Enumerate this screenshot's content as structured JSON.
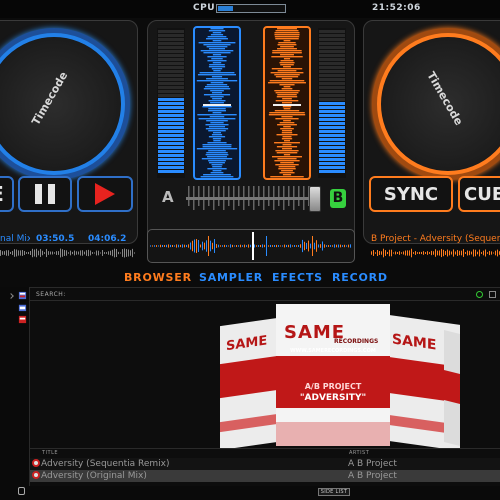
{
  "topbar": {
    "cpu_label": "CPU",
    "cpu_load": 0.22,
    "clock": "21:52:06"
  },
  "deck_left": {
    "platter_label": "Timecode",
    "cue_label": "E",
    "track_title": "nal Mix)",
    "elapsed": "03:50.5",
    "remaining": "04:06.2",
    "accent": "#2a8cff"
  },
  "deck_right": {
    "platter_label": "Timecode",
    "sync_label": "SYNC",
    "cue_label": "CUE",
    "track_title": "B Project - Adversity (Sequentia",
    "accent": "#ff7c1e"
  },
  "mixer": {
    "label_a": "A",
    "label_b": "B",
    "crossfader": 1.0
  },
  "nav": {
    "tabs": [
      "BROWSER",
      "SAMPLER",
      "EFECTS",
      "RECORD"
    ],
    "active": "BROWSER"
  },
  "browser": {
    "search_label": "SEARCH:",
    "search_value": "",
    "cover": {
      "logo": "SAME",
      "logo_sub": "RECORDINGS",
      "site": "WWW.SAMERECORDINGS.COM",
      "artist": "A/B PROJECT",
      "title": "\"ADVERSITY\""
    },
    "columns": {
      "title": "TITLE",
      "artist": "ARTIST"
    },
    "rows": [
      {
        "title": "Adversity (Sequentia Remix)",
        "artist": "A B Project"
      },
      {
        "title": "Adversity (Original Mix)",
        "artist": "A B Project"
      }
    ],
    "footer_button": "SIDE LIST"
  }
}
